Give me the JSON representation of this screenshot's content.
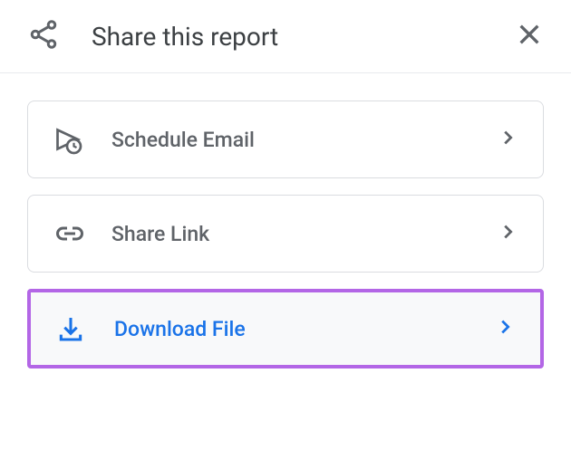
{
  "header": {
    "title": "Share this report"
  },
  "options": [
    {
      "label": "Schedule Email"
    },
    {
      "label": "Share Link"
    },
    {
      "label": "Download File"
    }
  ]
}
